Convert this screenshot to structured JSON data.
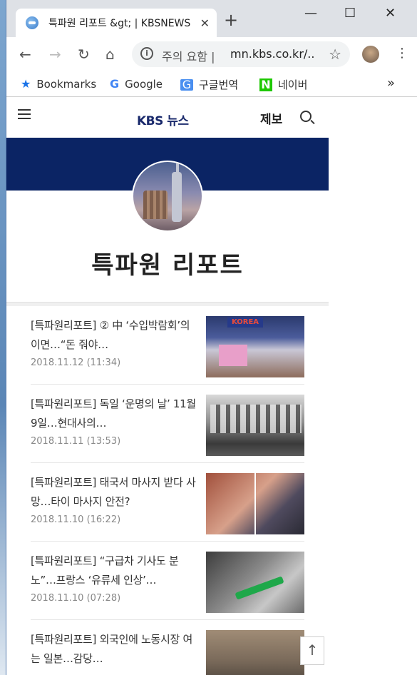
{
  "browser": {
    "tab_title": "특파원 리포트 &gt; | KBSNEWS",
    "new_tab_label": "+",
    "window_controls": {
      "minimize": "—",
      "maximize": "☐",
      "close": "✕"
    },
    "nav": {
      "back": "←",
      "forward": "→",
      "reload": "↻",
      "home": "⌂"
    },
    "omnibox": {
      "security_warning": "주의 요함",
      "separator": "|",
      "url": "mn.kbs.co.kr/...",
      "star": "☆"
    },
    "menu": "⋮"
  },
  "bookmarks": {
    "items": [
      {
        "label": "Bookmarks",
        "icon": "star-icon"
      },
      {
        "label": "Google",
        "icon": "google-icon"
      },
      {
        "label": "구글번역",
        "icon": "translate-icon"
      },
      {
        "label": "네이버",
        "icon": "naver-icon"
      }
    ],
    "overflow": "»"
  },
  "site": {
    "logo": "KBS 뉴스",
    "report_link": "제보",
    "section_title": "특파원 리포트",
    "scroll_top": "↑"
  },
  "articles": [
    {
      "headline": "[특파원리포트] ② 中 ‘수입박람회’의 이면…“돈 줘야…",
      "date": "2018.11.12  (11:34)"
    },
    {
      "headline": "[특파원리포트] 독일 ‘운명의 날’ 11월 9일…현대사의…",
      "date": "2018.11.11  (13:53)"
    },
    {
      "headline": "[특파원리포트] 태국서 마사지 받다 사망…타이 마사지 안전?",
      "date": "2018.11.10  (16:22)"
    },
    {
      "headline": "[특파원리포트] “구급차 기사도 분노”…프랑스 ‘유류세 인상’…",
      "date": "2018.11.10  (07:28)"
    },
    {
      "headline": "[특파원리포트] 외국인에 노동시장 여는 일본…감당…",
      "date": ""
    }
  ],
  "thumb_sign_text": "KOREA",
  "colors": {
    "banner": "#0b2464",
    "logo": "#1a2a6c",
    "tabstrip": "#dee1e6"
  }
}
